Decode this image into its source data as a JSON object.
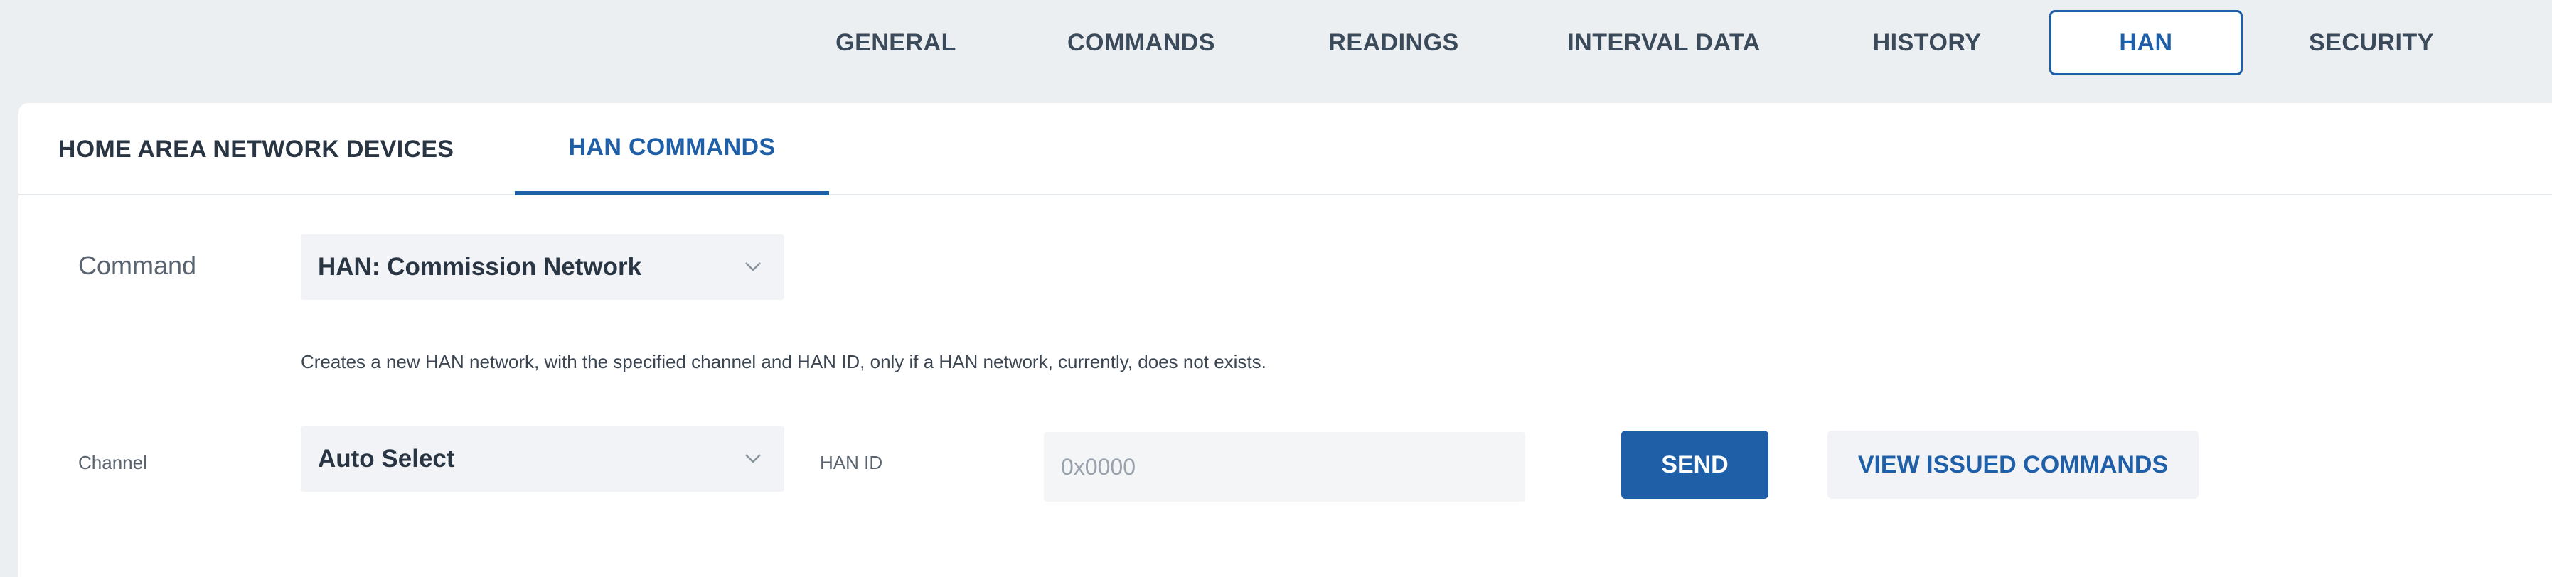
{
  "top_tabs": [
    {
      "label": "GENERAL"
    },
    {
      "label": "COMMANDS"
    },
    {
      "label": "READINGS"
    },
    {
      "label": "INTERVAL DATA"
    },
    {
      "label": "HISTORY"
    },
    {
      "label": "HAN",
      "active": true
    },
    {
      "label": "SECURITY"
    }
  ],
  "sub_tabs": [
    {
      "label": "HOME AREA NETWORK DEVICES"
    },
    {
      "label": "HAN COMMANDS",
      "active": true
    }
  ],
  "form": {
    "command_label": "Command",
    "command_value": "HAN: Commission Network",
    "description": "Creates a new HAN network, with the specified channel and HAN ID, only if a HAN network, currently, does not exists.",
    "channel_label": "Channel",
    "channel_value": "Auto Select",
    "han_id_label": "HAN ID",
    "han_id_placeholder": "0x0000",
    "han_id_value": "",
    "send_label": "SEND",
    "view_issued_label": "VIEW ISSUED COMMANDS"
  },
  "icons": {
    "dropdown": "chevron-down-icon"
  },
  "colors": {
    "accent": "#1f5fa8",
    "background": "#eceff1",
    "panel": "#ffffff",
    "text": "#2a3544"
  }
}
